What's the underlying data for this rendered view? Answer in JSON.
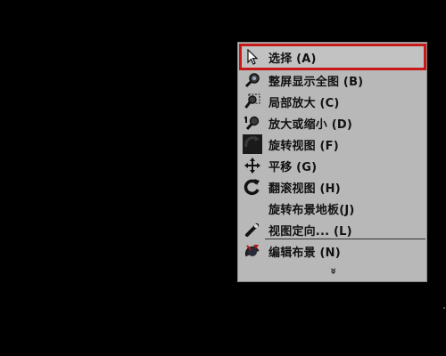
{
  "context_menu": {
    "items": [
      {
        "label": "选择 (A)",
        "icon": "pointer-arrow-icon",
        "selected": true
      },
      {
        "label": "整屏显示全图 (B)",
        "icon": "zoom-extents-icon"
      },
      {
        "label": "局部放大 (C)",
        "icon": "zoom-window-icon"
      },
      {
        "label": "放大或缩小 (D)",
        "icon": "zoom-in-out-icon"
      },
      {
        "label": "旋转视图 (F)",
        "icon": "rotate-view-icon"
      },
      {
        "label": "平移 (G)",
        "icon": "pan-icon"
      },
      {
        "label": "翻滚视图 (H)",
        "icon": "roll-view-icon"
      },
      {
        "label": "旋转布景地板(J)",
        "icon": ""
      },
      {
        "label": "视图定向... (L)",
        "icon": "view-orientation-icon"
      },
      {
        "label": "编辑布景 (N)",
        "icon": "edit-scene-icon"
      }
    ],
    "more_indicator": "»"
  },
  "colors": {
    "background": "#000000",
    "menu_background": "#b8b8b8",
    "selection_border": "#c81818"
  }
}
